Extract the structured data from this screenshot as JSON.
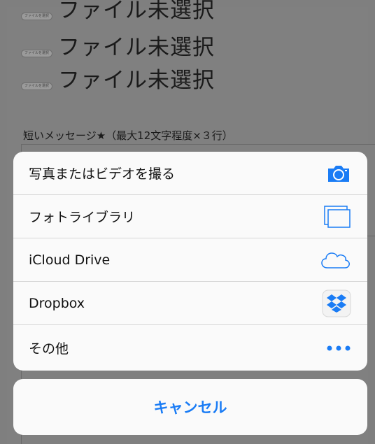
{
  "background": {
    "file_inputs": [
      {
        "button_label": "ファイルを選択",
        "status_text": "ファイル未選択"
      },
      {
        "button_label": "ファイルを選択",
        "status_text": "ファイル未選択"
      },
      {
        "button_label": "ファイルを選択",
        "status_text": "ファイル未選択"
      }
    ],
    "message_label": "短いメッセージ★（最大12文字程度×３行）"
  },
  "action_sheet": {
    "items": [
      {
        "label": "写真またはビデオを撮る",
        "icon": "camera-icon"
      },
      {
        "label": "フォトライブラリ",
        "icon": "photo-library-icon"
      },
      {
        "label": "iCloud Drive",
        "icon": "icloud-icon"
      },
      {
        "label": "Dropbox",
        "icon": "dropbox-icon"
      },
      {
        "label": "その他",
        "icon": "more-icon"
      }
    ],
    "cancel_label": "キャンセル",
    "accent_color": "#1a7cf5"
  }
}
